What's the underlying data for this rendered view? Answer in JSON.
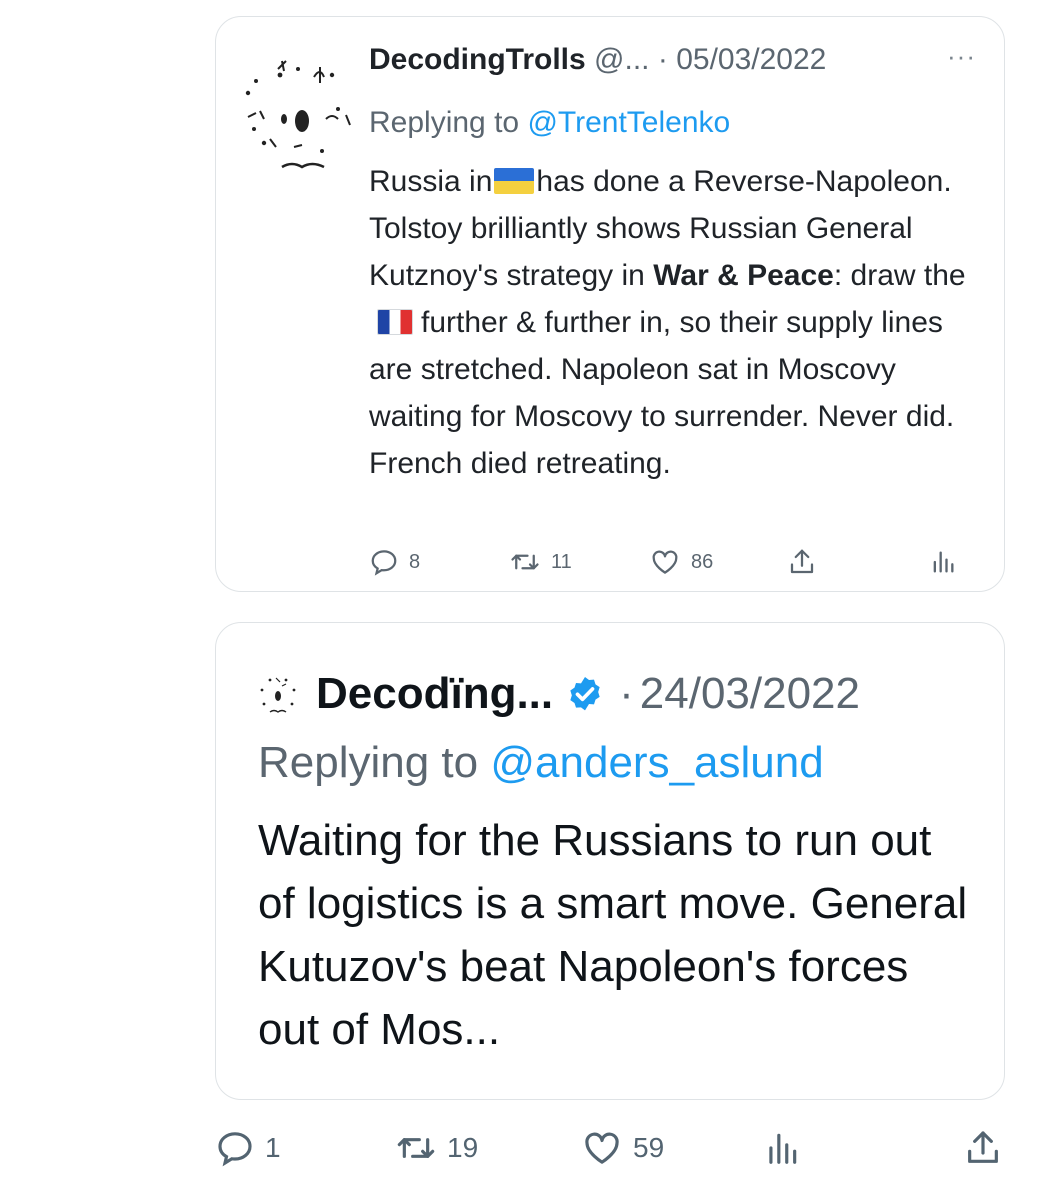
{
  "tweet1": {
    "author": "DecodingTrolls",
    "handle": "@...",
    "separator": "·",
    "date": "05/03/2022",
    "more_label": "···",
    "reply_prefix": "Replying to",
    "reply_handle": "@TrentTelenko",
    "body": {
      "p1": "Russia in",
      "p2": "has done a Reverse-Napoleon. Tolstoy brilliantly shows Russian General Kutznoy's strategy in ",
      "bold": "War & Peace",
      "p3": ": draw the",
      "p4": "further & further in, so their supply lines are stretched. Napoleon sat in Moscovy waiting for Moscovy to surrender. Never did. French died retreating."
    },
    "stats": {
      "replies": "8",
      "retweets": "11",
      "likes": "86"
    }
  },
  "tweet2": {
    "author": "Decodïng...",
    "separator": "·",
    "date": "24/03/2022",
    "reply_prefix": "Replying to",
    "reply_handle": "@anders_aslund",
    "body": "Waiting for the Russians to run out of logistics is a smart move. General Kutuzov's beat Napoleon's forces out of Mos..."
  },
  "bottom_stats": {
    "replies": "1",
    "retweets": "19",
    "likes": "59"
  },
  "colors": {
    "link": "#1d9bf0",
    "muted": "#536471",
    "verified": "#1d9bf0",
    "flag_ua": [
      "#2b6fd6",
      "#f4d03f"
    ],
    "flag_fr": [
      "#1f44a6",
      "#ffffff",
      "#e03131"
    ]
  },
  "icons": [
    "reply-icon",
    "retweet-icon",
    "like-icon",
    "share-icon",
    "analytics-icon",
    "verified-badge-icon",
    "more-icon"
  ]
}
